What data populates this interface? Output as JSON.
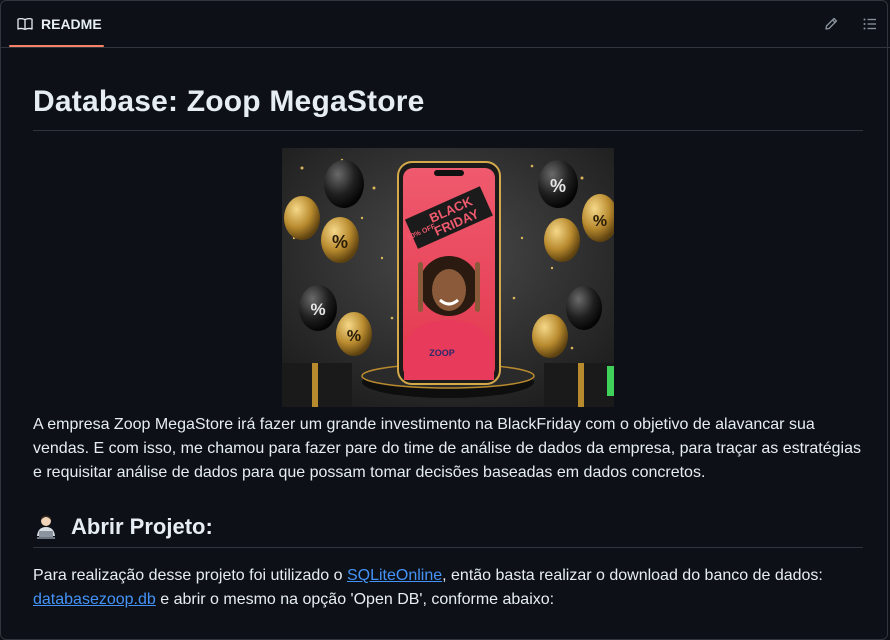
{
  "tab": {
    "label": "README",
    "icon": "book-icon"
  },
  "toolbar": {
    "edit_icon": "pencil-icon",
    "outline_icon": "list-icon"
  },
  "colors": {
    "accent_underline": "#f78166",
    "link": "#4493f8",
    "background": "#0d1117"
  },
  "readme": {
    "title": "Database: Zoop MegaStore",
    "hero_image": {
      "banner_text_line1": "BLACK",
      "banner_text_line2": "FRIDAY",
      "banner_discount": "50% OFF",
      "brand_text": "ZOOP",
      "balloon_symbol": "%"
    },
    "description": "A empresa Zoop MegaStore irá fazer um grande investimento na BlackFriday com o objetivo de alavancar sua vendas. E com isso, me chamou para fazer pare do time de análise de dados da empresa, para traçar as estratégias e requisitar análise de dados para que possam tomar decisões baseadas em dados concretos.",
    "section_heading": "Abrir Projeto:",
    "section_icon": "technologist-icon",
    "usage_text_1": "Para realização desse projeto foi utilizado o ",
    "usage_link_1": "SQLiteOnline",
    "usage_text_2": ", então basta realizar o download do banco de dados: ",
    "usage_link_2": "databasezoop.db",
    "usage_text_3": " e abrir o mesmo na opção 'Open DB', conforme abaixo:"
  }
}
